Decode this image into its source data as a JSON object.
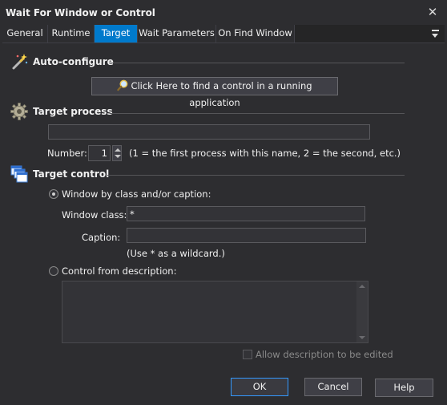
{
  "window": {
    "title": "Wait For Window or Control",
    "close_glyph": "✕"
  },
  "tabs": [
    {
      "label": "General",
      "active": false
    },
    {
      "label": "Runtime",
      "active": false
    },
    {
      "label": "Target",
      "active": true
    },
    {
      "label": "Wait Parameters",
      "active": false
    },
    {
      "label": "On Find Window",
      "active": false
    }
  ],
  "auto_configure": {
    "heading": "Auto-configure",
    "icon": "magic-wand-icon",
    "find_button_label": "Click Here to find a control in a running application",
    "find_button_icon": "magnifier-icon"
  },
  "target_process": {
    "heading": "Target process",
    "icon": "gear-icon",
    "process_value": "",
    "number_label": "Number:",
    "number_value": "1",
    "number_hint": "(1 = the first process with this name, 2 = the second, etc.)"
  },
  "target_control": {
    "heading": "Target control",
    "icon": "windows-stack-icon",
    "option_class_caption": "Window by class and/or caption:",
    "option_class_caption_selected": true,
    "window_class_label": "Window class:",
    "window_class_value": "*",
    "caption_label": "Caption:",
    "caption_value": "",
    "wildcard_hint": "(Use * as a wildcard.)",
    "option_description": "Control from description:",
    "option_description_selected": false,
    "description_value": "",
    "allow_edit_label": "Allow description to be edited",
    "allow_edit_checked": false
  },
  "footer": {
    "ok_label": "OK",
    "cancel_label": "Cancel",
    "help_label": "Help"
  },
  "colors": {
    "accent": "#007acc",
    "background": "#2d2d30",
    "text": "#f1f1f1"
  }
}
